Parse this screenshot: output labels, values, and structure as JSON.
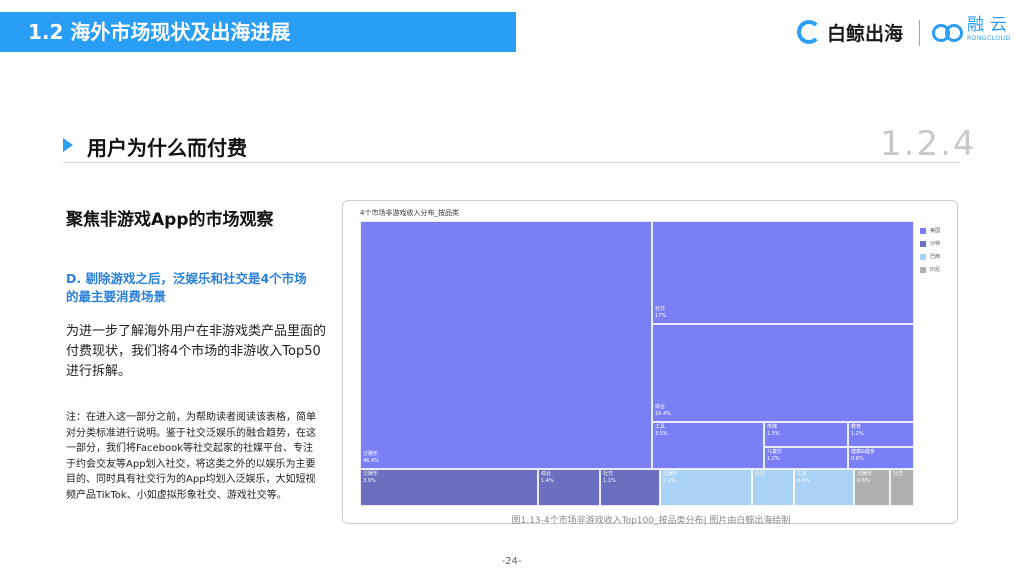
{
  "header": {
    "title": "1.2 海外市场现状及出海进展"
  },
  "logos": {
    "brand1": "白鲸出海",
    "brand2_zh": "融云",
    "brand2_en": "RONGCLOUD"
  },
  "section": {
    "title": "用户为什么而付费",
    "number": "1.2.4"
  },
  "left": {
    "heading": "聚焦非游戏App的市场观察",
    "subheading": "D. 剔除游戏之后，泛娱乐和社交是4个市场的最主要消费场景",
    "paragraph": "为进一步了解海外用户在非游戏类产品里面的付费现状，我们将4个市场的非游收入Top50进行拆解。",
    "note": "注：在进入这一部分之前，为帮助读者阅读该表格，简单对分类标准进行说明。鉴于社交泛娱乐的融合趋势，在这一部分，我们将Facebook等社交起家的社媒平台、专注于约会交友等App划入社交，将这类之外的以娱乐为主要目的、同时具有社交行为的App均划入泛娱乐，大如短视频产品TikTok、小如虚拟形象社交、游戏社交等。"
  },
  "chart": {
    "title": "4个市场非游戏收入分布_按品类",
    "caption": "图1.13-4个市场非游戏收入Top100_按品类分布| 图片由白鲸出海绘制",
    "legend": [
      "美国",
      "沙特",
      "巴西",
      "印尼"
    ],
    "colors": {
      "美国": "#7b7ff5",
      "沙特": "#6a6fc0",
      "巴西": "#a9d2f5",
      "印尼": "#b0b0b0"
    }
  },
  "chart_data": {
    "type": "treemap",
    "title": "4个市场非游戏收入分布_按品类",
    "legend": [
      "美国",
      "沙特",
      "巴西",
      "印尼"
    ],
    "groups": [
      {
        "name": "美国",
        "items": [
          {
            "label": "泛娱乐",
            "value": "46.4%"
          },
          {
            "label": "社交",
            "value": "17%"
          },
          {
            "label": "综合",
            "value": "16.4%"
          },
          {
            "label": "工具",
            "value": "3.5%"
          },
          {
            "label": "传媒",
            "value": "1.5%"
          },
          {
            "label": "儿童乐",
            "value": "1.2%"
          },
          {
            "label": "教育",
            "value": "1.2%"
          },
          {
            "label": "健康&健身",
            "value": "0.8%"
          }
        ]
      },
      {
        "name": "沙特",
        "items": [
          {
            "label": "泛娱乐",
            "value": "3.9%"
          },
          {
            "label": "综合",
            "value": "1.4%"
          },
          {
            "label": "社交",
            "value": "1.1%"
          }
        ]
      },
      {
        "name": "巴西",
        "items": [
          {
            "label": "泛娱乐",
            "value": "2.1%"
          },
          {
            "label": "社交",
            "value": ""
          },
          {
            "label": "工具",
            "value": "0.4%"
          }
        ]
      },
      {
        "name": "印尼",
        "items": [
          {
            "label": "泛娱乐",
            "value": "0.6%"
          },
          {
            "label": "社交",
            "value": ""
          }
        ]
      }
    ]
  },
  "page": {
    "number": "-24-"
  }
}
